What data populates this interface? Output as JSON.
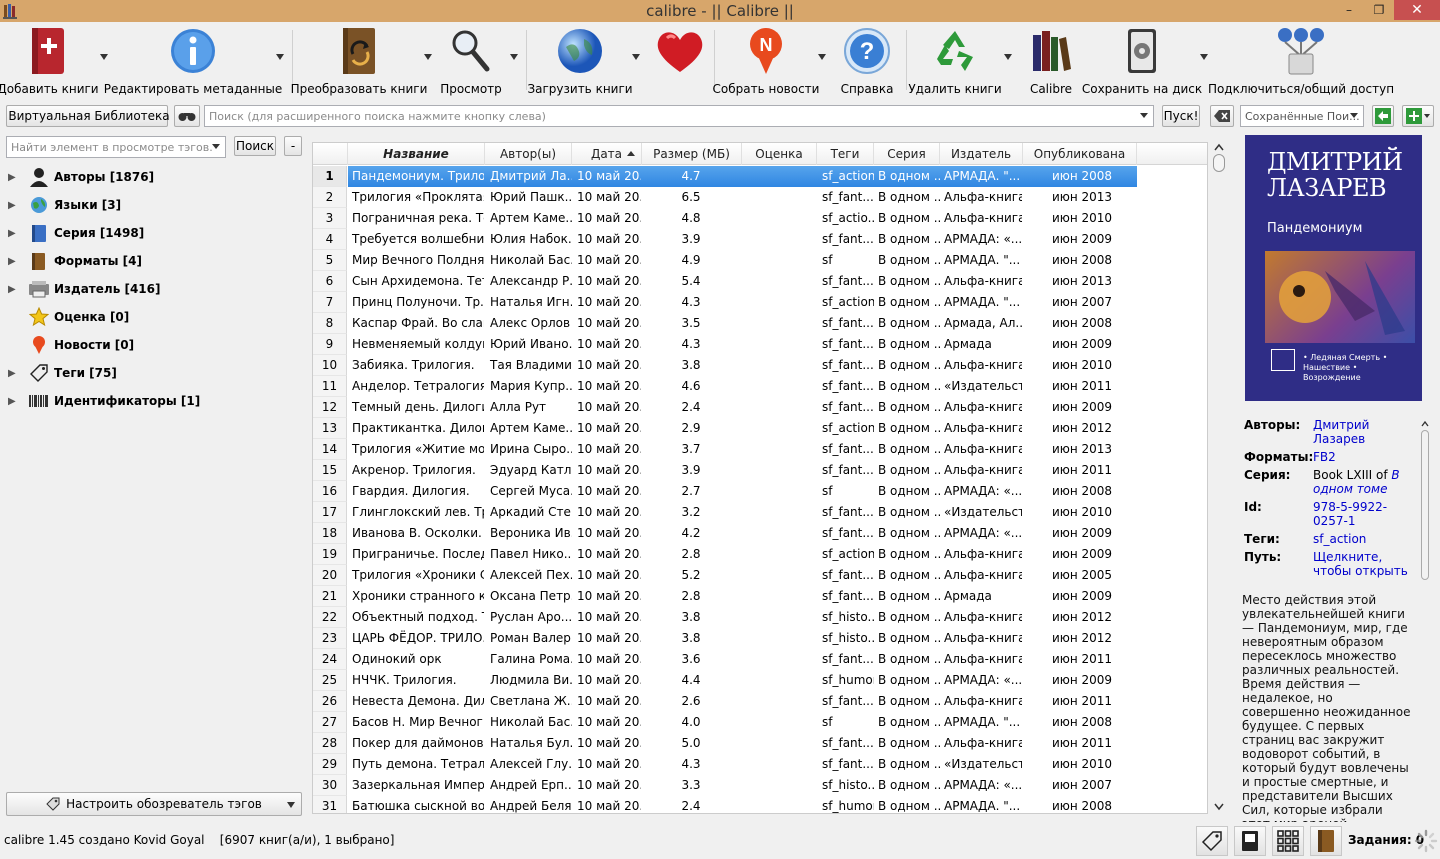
{
  "window": {
    "title": "calibre - || Calibre ||",
    "minimize": "–",
    "maximize": "❐",
    "close": "✕"
  },
  "toolbar": {
    "add": "Добавить книги",
    "edit_meta": "Редактировать метаданные",
    "convert": "Преобразовать книги",
    "view": "Просмотр",
    "download": "Загрузить книги",
    "news": "Собрать новости",
    "news_icon_letter": "N",
    "help": "Справка",
    "remove": "Удалить книги",
    "library": "Calibre",
    "save": "Сохранить на диск",
    "connect": "Подключиться/общий доступ"
  },
  "searchbar": {
    "virtual_library": "Виртуальная Библиотека",
    "search_placeholder": "Поиск (для расширенного поиска нажмите кнопку слева)",
    "go": "Пуск!",
    "saved_placeholder": "Сохранённые Пои..."
  },
  "tag_browser": {
    "find_placeholder": "Найти элемент в просмотре тэгов.",
    "find_button": "Поиск",
    "collapse_button": "-",
    "items": [
      {
        "label": "Авторы [1876]",
        "expand": "▶"
      },
      {
        "label": "Языки [3]",
        "expand": "▶"
      },
      {
        "label": "Серия [1498]",
        "expand": "▶"
      },
      {
        "label": "Форматы [4]",
        "expand": "▶"
      },
      {
        "label": "Издатель [416]",
        "expand": "▶"
      },
      {
        "label": "Оценка [0]",
        "expand": ""
      },
      {
        "label": "Новости [0]",
        "expand": ""
      },
      {
        "label": "Теги [75]",
        "expand": "▶"
      },
      {
        "label": "Идентификаторы [1]",
        "expand": "▶"
      }
    ],
    "configure": "Настроить обозреватель тэгов"
  },
  "booklist": {
    "columns": [
      "Название",
      "Автор(ы)",
      "Дата",
      "Размер (МБ)",
      "Оценка",
      "Теги",
      "Серия",
      "Издатель",
      "Опубликована"
    ],
    "rows": [
      [
        "1",
        "Пандемониум. Трило...",
        "Дмитрий Ла...",
        "10 май 20...",
        "4.7",
        "",
        "sf_action",
        "В одном ...",
        "АРМАДА. \"...",
        "июн 2008"
      ],
      [
        "2",
        "Трилогия «Проклятая...",
        "Юрий Пашк...",
        "10 май 20...",
        "6.5",
        "",
        "sf_fant...",
        "В одном ...",
        "Альфа-книга",
        "июн 2013"
      ],
      [
        "3",
        "Пограничная река. Те...",
        "Артем Каме...",
        "10 май 20...",
        "4.8",
        "",
        "sf_actio...",
        "В одном ...",
        "Альфа-книга",
        "июн 2010"
      ],
      [
        "4",
        "Требуется волшебни...",
        "Юлия Набок...",
        "10 май 20...",
        "3.9",
        "",
        "sf_fant...",
        "В одном ...",
        "АРМАДА: «...",
        "июн 2009"
      ],
      [
        "5",
        "Мир Вечного Полдня...",
        "Николай Бас...",
        "10 май 20...",
        "4.9",
        "",
        "sf",
        "В одном ...",
        "АРМАДА. \"...",
        "июн 2008"
      ],
      [
        "6",
        "Сын Архидемона. Тет...",
        "Александр Р...",
        "10 май 20...",
        "5.4",
        "",
        "sf_fant...",
        "В одном ...",
        "Альфа-книга",
        "июн 2013"
      ],
      [
        "7",
        "Принц Полуночи. Тр...",
        "Наталья Игн...",
        "10 май 20...",
        "4.3",
        "",
        "sf_action",
        "В одном ...",
        "АРМАДА. \"...",
        "июн 2007"
      ],
      [
        "8",
        "Каспар Фрай. Во слав...",
        "Алекс Орлов",
        "10 май 20...",
        "3.5",
        "",
        "sf_fant...",
        "В одном ...",
        "Армада, Ал...",
        "июн 2008"
      ],
      [
        "9",
        "Невменяемый колдун...",
        "Юрий Ивано...",
        "10 май 20...",
        "4.3",
        "",
        "sf_fant...",
        "В одном ...",
        "Армада",
        "июн 2009"
      ],
      [
        "10",
        "Забияка. Трилогия.",
        "Тая Владими...",
        "10 май 20...",
        "3.8",
        "",
        "sf_fant...",
        "В одном ...",
        "Альфа-книга",
        "июн 2010"
      ],
      [
        "11",
        "Анделор. Тетралогия.",
        "Мария Купр...",
        "10 май 20...",
        "4.6",
        "",
        "sf_fant...",
        "В одном ...",
        "«Издательст...",
        "июн 2011"
      ],
      [
        "12",
        "Темный день. Дилогия.",
        "Алла Рут",
        "10 май 20...",
        "2.4",
        "",
        "sf_fant...",
        "В одном ...",
        "Альфа-книга",
        "июн 2009"
      ],
      [
        "13",
        "Практикантка. Дилогия.",
        "Артем Каме...",
        "10 май 20...",
        "2.9",
        "",
        "sf_action",
        "В одном ...",
        "Альфа-книга",
        "июн 2012"
      ],
      [
        "14",
        "Трилогия «Житие мое»",
        "Ирина Сыро...",
        "10 май 20...",
        "3.7",
        "",
        "sf_fant...",
        "В одном ...",
        "Альфа-книга",
        "июн 2013"
      ],
      [
        "15",
        "Акренор. Трилогия.",
        "Эдуард Катлас",
        "10 май 20...",
        "3.9",
        "",
        "sf_fant...",
        "В одном ...",
        "Альфа-книга",
        "июн 2011"
      ],
      [
        "16",
        "Гвардия. Дилогия.",
        "Сергей Муса...",
        "10 май 20...",
        "2.7",
        "",
        "sf",
        "В одном ...",
        "АРМАДА: «...",
        "июн 2008"
      ],
      [
        "17",
        "Глинглокский лев. Тр...",
        "Аркадий Сте...",
        "10 май 20...",
        "3.2",
        "",
        "sf_fant...",
        "В одном ...",
        "«Издательст...",
        "июн 2010"
      ],
      [
        "18",
        "Иванова В. Осколки. ...",
        "Вероника Ив...",
        "10 май 20...",
        "4.2",
        "",
        "sf_fant...",
        "В одном ...",
        "АРМАДА: «...",
        "июн 2009"
      ],
      [
        "19",
        "Приграничье. Послед...",
        "Павел Нико...",
        "10 май 20...",
        "2.8",
        "",
        "sf_action",
        "В одном ...",
        "Альфа-книга",
        "июн 2009"
      ],
      [
        "20",
        "Трилогия «Хроники С...",
        "Алексей Пех...",
        "10 май 20...",
        "5.2",
        "",
        "sf_fant...",
        "В одном ...",
        "Альфа-книга",
        "июн 2005"
      ],
      [
        "21",
        "Хроники странного к...",
        "Оксана Петр...",
        "10 май 20...",
        "2.8",
        "",
        "sf_fant...",
        "В одном ...",
        "Армада",
        "июн 2009"
      ],
      [
        "22",
        "Объектный подход. То...",
        "Руслан Аро...",
        "10 май 20...",
        "3.8",
        "",
        "sf_histo...",
        "В одном ...",
        "Альфа-книга",
        "июн 2012"
      ],
      [
        "23",
        "ЦАРЬ ФЁДОР. ТРИЛО...",
        "Роман Валер...",
        "10 май 20...",
        "3.8",
        "",
        "sf_histo...",
        "В одном ...",
        "Альфа-книга",
        "июн 2012"
      ],
      [
        "24",
        "Одинокий орк",
        "Галина Рома...",
        "10 май 20...",
        "3.6",
        "",
        "sf_fant...",
        "В одном ...",
        "Альфа-книга",
        "июн 2011"
      ],
      [
        "25",
        "НЧЧК. Трилогия.",
        "Людмила Ви...",
        "10 май 20...",
        "4.4",
        "",
        "sf_humor",
        "В одном ...",
        "АРМАДА: «...",
        "июн 2009"
      ],
      [
        "26",
        "Невеста Демона. Дил...",
        "Светлана Ж...",
        "10 май 20...",
        "2.6",
        "",
        "sf_fant...",
        "В одном ...",
        "Альфа-книга",
        "июн 2011"
      ],
      [
        "27",
        "Басов Н. Мир Вечног...",
        "Николай Бас...",
        "10 май 20...",
        "4.0",
        "",
        "sf",
        "В одном ...",
        "АРМАДА. \"...",
        "июн 2008"
      ],
      [
        "28",
        "Покер для даймонов. ...",
        "Наталья Бул...",
        "10 май 20...",
        "5.0",
        "",
        "sf_fant...",
        "В одном ...",
        "Альфа-книга",
        "июн 2011"
      ],
      [
        "29",
        "Путь демона. Тетрало...",
        "Алексей Глу...",
        "10 май 20...",
        "4.3",
        "",
        "sf_fant...",
        "В одном ...",
        "«Издательст...",
        "июн 2010"
      ],
      [
        "30",
        "Зазеркальная Импер...",
        "Андрей Ерп...",
        "10 май 20...",
        "3.3",
        "",
        "sf_histo...",
        "В одном ...",
        "АРМАДА: «...",
        "июн 2007"
      ],
      [
        "31",
        "Батюшка сыскной во...",
        "Андрей Беля...",
        "10 май 20...",
        "2.4",
        "",
        "sf_humor",
        "В одном ...",
        "АРМАДА. \"...",
        "июн 2008"
      ]
    ]
  },
  "details": {
    "cover_author": "ДМИТРИЙ ЛАЗАРЕВ",
    "cover_title": "Пандемониум",
    "cover_sub": "• Ледяная Смерть • Нашествие • Возрождение",
    "authors_label": "Авторы:",
    "authors_value": "Дмитрий Лазарев",
    "formats_label": "Форматы:",
    "formats_value": "FB2",
    "series_label": "Серия:",
    "series_prefix": "Book LXIII of",
    "series_value": "В одном томе",
    "id_label": "Id:",
    "id_value": "978-5-9922-0257-1",
    "tags_label": "Теги:",
    "tags_value": "sf_action",
    "path_label": "Путь:",
    "path_value": "Щелкните, чтобы открыть",
    "description": "Место действия этой увлекательнейшей книги — Пандемониум, мир, где невероятным образом пересеклось множество различных реальностей. Время действия — недалекое, но совершенно неожиданное будущее. С первых страниц вас закружит водоворот событий, в который будут вовлечены и простые смертные, и представители Высших Сил, которые избрали этот мир ареной"
  },
  "statusbar": {
    "text": "calibre 1.45 создано Kovid Goyal    [6907 книг(а/и), 1 выбрано]",
    "jobs": "Задания: 0"
  },
  "colors": {
    "titlebar": "#d7a66b",
    "selection": "#3a8fe6",
    "link": "#0000cc"
  }
}
